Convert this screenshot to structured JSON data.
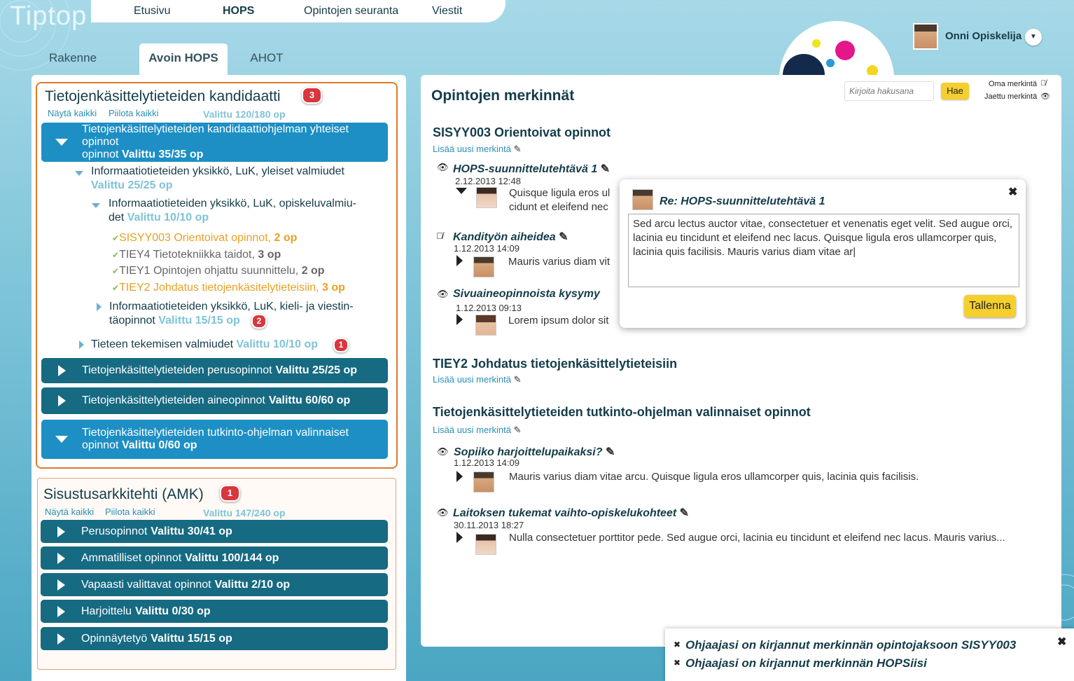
{
  "app": {
    "logo": "Tiptop"
  },
  "topnav": [
    "Etusivu",
    "HOPS",
    "Opintojen seuranta",
    "Viestit"
  ],
  "subtabs": [
    "Rakenne",
    "Avoin HOPS",
    "AHOT"
  ],
  "user": {
    "name": "Onni Opiskelija"
  },
  "left": {
    "prog1": {
      "title": "Tietojenkäsittelytieteiden kandidaatti",
      "badge": "3",
      "show_all": "Näytä kaikki",
      "hide_all": "Piilota kaikki",
      "valittu": "Valittu 120/180 op",
      "bar_open": {
        "text": "Tietojenkäsittelytieteiden kandidaattiohjelman yhteiset opinnot",
        "val": "Valittu 35/35 op"
      },
      "tree": {
        "n1": {
          "text": "Informaatiotieteiden yksikkö, LuK, yleiset valmiudet",
          "val": "Valittu 25/25 op"
        },
        "n2a": {
          "text": "Informaatiotieteiden yksikkö, LuK, opiskeluvalmiu-",
          "text2": "det",
          "val": "Valittu 10/10 op"
        },
        "courses": [
          {
            "code": "SISYY003 Orientoivat opinnot,",
            "op": "2 op"
          },
          {
            "code": "TIEY4 Tietotekniikka taidot,",
            "op": "3 op"
          },
          {
            "code": "TIEY1 Opintojen ohjattu suunnittelu,",
            "op": "2 op"
          },
          {
            "code": "TIEY2 Johdatus tietojenkäsitelytieteisiin,",
            "op": "3 op"
          }
        ],
        "n3": {
          "text": "Informaatiotieteiden yksikkö, LuK, kieli- ja viestin-",
          "text2": "täopinnot",
          "val": "Valittu 15/15 op",
          "badge": "2"
        },
        "n4": {
          "text": "Tieteen tekemisen valmiudet",
          "val": "Valittu 10/10 op",
          "badge": "1"
        }
      },
      "bars": [
        {
          "text": "Tietojenkäsittelytieteiden perusopinnot",
          "val": "Valittu 25/25 op"
        },
        {
          "text": "Tietojenkäsittelytieteiden aineopinnot",
          "val": "Valittu 60/60 op"
        }
      ],
      "bar_open2": {
        "text": "Tietojenkäsittelytieteiden tutkinto-ohjelman valinnaiset",
        "text2": "opinnot",
        "val": "Valittu 0/60 op"
      }
    },
    "prog2": {
      "title": "Sisustusarkkitehti (AMK)",
      "badge": "1",
      "show_all": "Näytä kaikki",
      "hide_all": "Piilota kaikki",
      "valittu": "Valittu 147/240 op",
      "bars": [
        {
          "text": "Perusopinnot",
          "val": "Valittu 30/41 op"
        },
        {
          "text": "Ammatilliset opinnot",
          "val": "Valittu 100/144 op"
        },
        {
          "text": "Vapaasti valittavat opinnot",
          "val": "Valittu 2/10 op"
        },
        {
          "text": "Harjoittelu",
          "val": "Valittu 0/30 op"
        },
        {
          "text": "Opinnäytetyö",
          "val": "Valittu 15/15 op"
        }
      ]
    }
  },
  "right": {
    "title": "Opintojen merkinnät",
    "search_placeholder": "Kirjoita hakusana",
    "search_btn": "Hae",
    "legend_own": "Oma merkintä",
    "legend_shared": "Jaettu merkintä",
    "add_new": "Lisää uusi merkintä",
    "sections": [
      {
        "title": "SISYY003 Orientoivat opinnot"
      },
      {
        "title": "TIEY2 Johdatus tietojenkäsittelytieteisiin"
      },
      {
        "title": "Tietojenkäsittelytieteiden tutkinto-ohjelman valinnaiset opinnot"
      }
    ],
    "entries": [
      {
        "title": "HOPS-suunnittelutehtävä 1",
        "date": "2.12.2013 12:48",
        "text": "Quisque ligula eros ul",
        "text2": "cidunt et eleifend nec"
      },
      {
        "title": "Kandityön aiheidea",
        "date": "1.12.2013 14:09",
        "text": "Mauris varius diam vit"
      },
      {
        "title": "Sivuaineopinnoista kysymy",
        "date": "1.12.2013 09:13",
        "text": "Lorem ipsum dolor sit"
      },
      {
        "title": "Sopiiko harjoittelupaikaksi?",
        "date": "1.12.2013 14:09",
        "text": "Mauris varius diam vitae arcu. Quisque ligula eros ullamcorper quis, lacinia quis facilisis."
      },
      {
        "title": "Laitoksen tukemat vaihto-opiskelukohteet",
        "date": "30.11.2013 18:27",
        "text": "Nulla consectetuer porttitor pede. Sed augue orci, lacinia eu tincidunt et eleifend nec lacus. Mauris varius..."
      }
    ]
  },
  "popup": {
    "title": "Re: HOPS-suunnittelutehtävä 1",
    "body": "Sed arcu lectus auctor vitae, consectetuer et venenatis eget velit. Sed augue orci, lacinia eu tincidunt et eleifend nec lacus. Quisque ligula eros ullamcorper quis, lacinia quis facilisis. Mauris varius diam vitae ar|",
    "save": "Tallenna"
  },
  "notifications": [
    "Ohjaajasi on kirjannut merkinnän opintojaksoon SISYY003",
    "Ohjaajasi on kirjannut merkinnän HOPSiisi"
  ],
  "colors": {
    "bar": "#166a82",
    "bar_open": "#1d8fc4",
    "badge": "#d9363e",
    "accent_yellow": "#f5cf2e",
    "course_orange": "#e8a024",
    "prog_border": "#e07a2a"
  }
}
